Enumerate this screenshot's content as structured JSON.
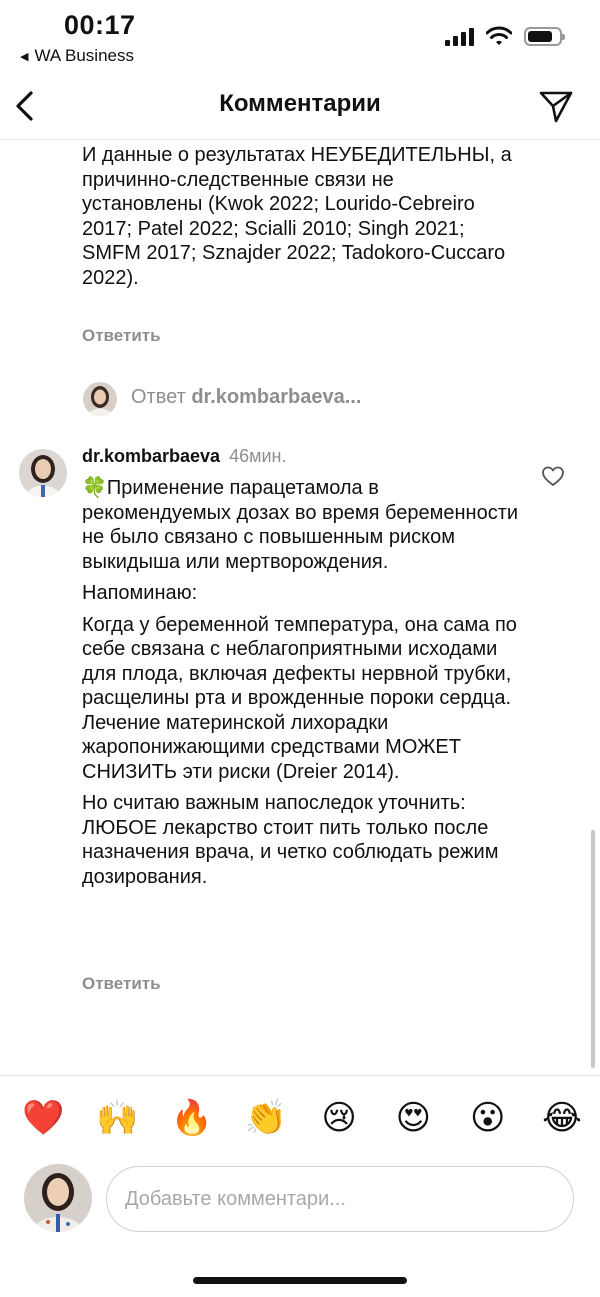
{
  "status_bar": {
    "time": "00:17",
    "back_app": "WA Business",
    "icons": [
      "signal-icon",
      "wifi-icon",
      "battery-icon"
    ]
  },
  "nav": {
    "title": "Комментарии",
    "back_icon": "chevron-left-icon",
    "share_icon": "paper-plane-icon"
  },
  "comments": [
    {
      "text": "И данные о результатах НЕУБЕДИТЕЛЬНЫ,  а причинно-следственные связи не установлены (Kwok 2022; Lourido-Cebreiro 2017; Patel 2022; Scialli 2010; Singh 2021; SMFM 2017; Sznajder 2022; Tadokoro-Cuccaro 2022).",
      "reply_label": "Ответить"
    },
    {
      "username": "dr.kombarbaeva",
      "time": "46мин.",
      "paragraphs": [
        "🍀Применение парацетамола в рекомендуемых дозах во время беременности не было связано с повышенным риском выкидыша или мертворождения.",
        "Напоминаю:",
        "Когда у беременной температура, она сама по себе связана с неблагоприятными исходами для плода, включая дефекты нервной трубки, расщелины рта и врожденные пороки сердца. Лечение материнской лихорадки жаропонижающими средствами МОЖЕТ СНИЗИТЬ эти риски (Dreier 2014).",
        "Но считаю важным напоследок уточнить: ЛЮБОЕ лекарство стоит пить только после назначения врача, и четко соблюдать режим дозирования."
      ],
      "reply_label": "Ответить"
    }
  ],
  "thread": {
    "prefix": "Ответ",
    "user": "dr.kombarbaeva..."
  },
  "reactions": [
    "❤️",
    "🙌",
    "🔥",
    "👏",
    "😢",
    "😍",
    "😮",
    "😂"
  ],
  "input": {
    "placeholder": "Добавьте комментари..."
  }
}
